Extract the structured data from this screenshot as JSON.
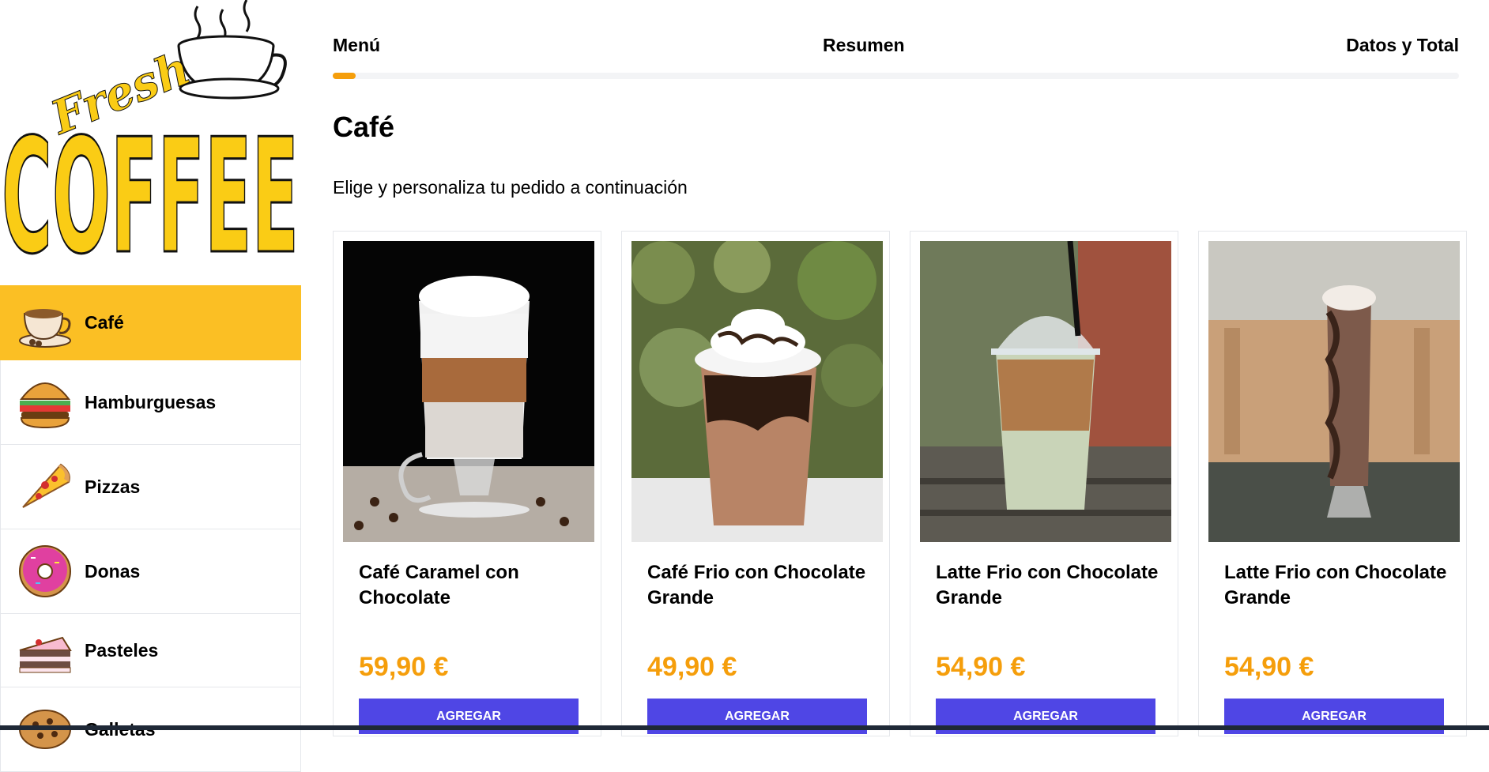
{
  "logo": {
    "line1": "Fresh",
    "line2": "COFFEE"
  },
  "steps": {
    "menu": "Menú",
    "summary": "Resumen",
    "total": "Datos y Total",
    "progress": 0.02
  },
  "heading": "Café",
  "subtitle": "Elige y personaliza tu pedido a continuación",
  "categories": [
    {
      "label": "Café",
      "icon": "coffee-cup-icon",
      "active": true
    },
    {
      "label": "Hamburguesas",
      "icon": "burger-icon"
    },
    {
      "label": "Pizzas",
      "icon": "pizza-icon"
    },
    {
      "label": "Donas",
      "icon": "donut-icon"
    },
    {
      "label": "Pasteles",
      "icon": "cake-icon"
    },
    {
      "label": "Galletas",
      "icon": "cookie-icon"
    }
  ],
  "products": [
    {
      "name": "Café Caramel con Chocolate",
      "price": "59,90 €",
      "button": "Agregar"
    },
    {
      "name": "Café Frio con Chocolate Grande",
      "price": "49,90 €",
      "button": "Agregar"
    },
    {
      "name": "Latte Frio con Chocolate Grande",
      "price": "54,90 €",
      "button": "Agregar"
    },
    {
      "name": "Latte Frio con Chocolate Grande",
      "price": "54,90 €",
      "button": "Agregar"
    }
  ],
  "colors": {
    "accent": "#fbbf24",
    "price": "#f59e0b",
    "button": "#4f46e5",
    "logo": "#facc15"
  }
}
